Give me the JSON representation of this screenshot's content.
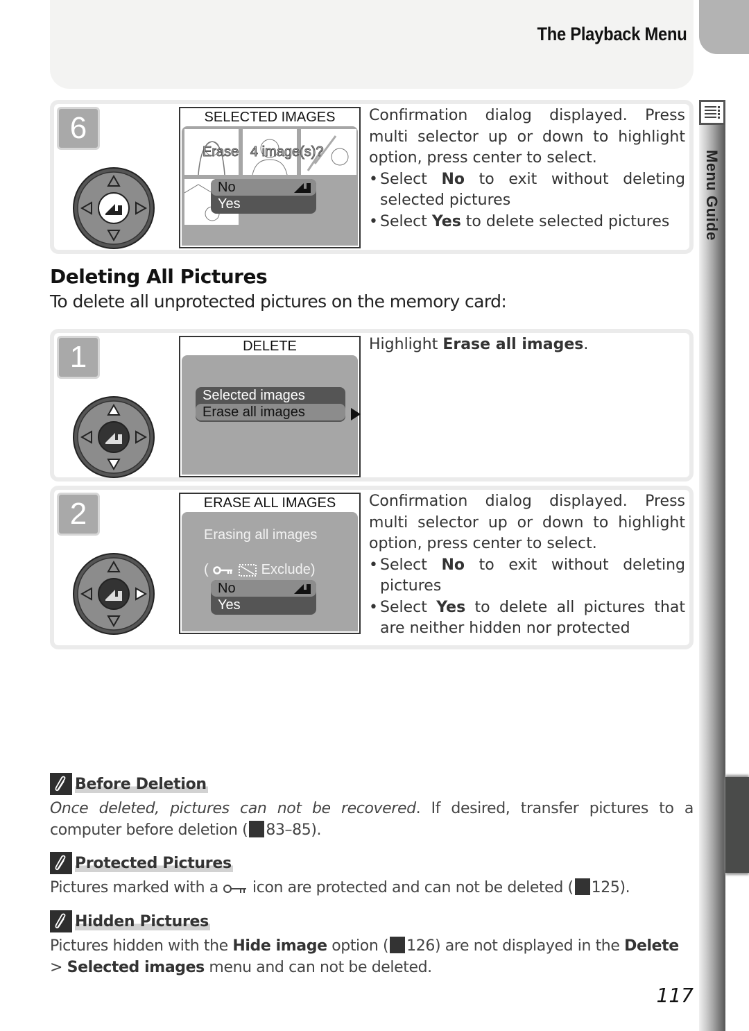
{
  "header": {
    "title": "The Playback Menu"
  },
  "side_tab": {
    "label": "Menu Guide",
    "icon": "menu-list-icon"
  },
  "step6": {
    "number": "6",
    "screen": {
      "title": "SELECTED IMAGES",
      "prompt": "Erase   4 image(s)?",
      "options": [
        "No",
        "Yes"
      ],
      "selected": "No"
    },
    "text": {
      "intro": "Confirmation dialog displayed.  Press multi selector up or down to highlight option, press center to select.",
      "bullets": [
        {
          "pre": "Select ",
          "bold": "No",
          "post": " to exit without deleting selected pictures"
        },
        {
          "pre": "Select ",
          "bold": "Yes",
          "post": " to delete selected pictures"
        }
      ]
    }
  },
  "section": {
    "heading": "Deleting All Pictures",
    "intro": "To delete all unprotected pictures on the memory card:"
  },
  "step1": {
    "number": "1",
    "screen": {
      "title": "DELETE",
      "options": [
        "Selected images",
        "Erase all images"
      ],
      "selected": "Erase all images"
    },
    "text": {
      "pre": "Highlight ",
      "bold": "Erase all images",
      "post": "."
    }
  },
  "step2": {
    "number": "2",
    "screen": {
      "title": "ERASE ALL IMAGES",
      "message": "Erasing all images",
      "exclude_open": "(",
      "exclude_label": "Exclude)",
      "options": [
        "No",
        "Yes"
      ],
      "selected": "No"
    },
    "text": {
      "intro": "Confirmation dialog displayed.  Press multi selector up or down to highlight option, press center to select.",
      "bullets": [
        {
          "pre": "Select ",
          "bold": "No",
          "post": " to exit without deleting pictures"
        },
        {
          "pre": "Select ",
          "bold": "Yes",
          "post": " to delete all pictures that are neither hidden nor protected"
        }
      ]
    }
  },
  "notes": [
    {
      "title": "Before Deletion",
      "italic": "Once deleted, pictures can not be recovered",
      "text": ".  If desired, transfer pictures to a computer before deletion (",
      "ref": "83–85",
      "end": ")."
    },
    {
      "title": "Protected Pictures",
      "pre": "Pictures marked with a ",
      "post": " icon are protected and can not be deleted (",
      "ref": "125",
      "end": ")."
    },
    {
      "title": "Hidden Pictures",
      "pre": "Pictures hidden with the ",
      "bold1": "Hide image",
      "mid": " option (",
      "ref": "126",
      "mid2": ") are not displayed in the ",
      "bold2": "Delete",
      "gt": " > ",
      "bold3": "Selected images",
      "end": " menu and can not be deleted."
    }
  ],
  "page_number": "117"
}
